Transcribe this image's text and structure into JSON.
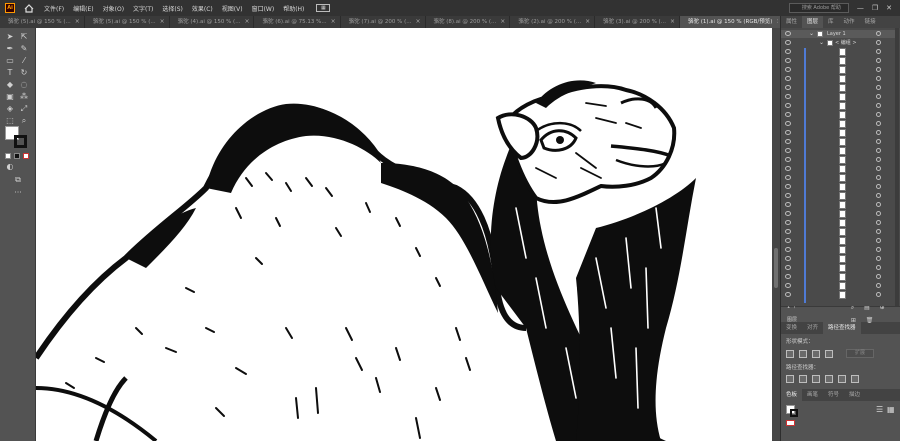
{
  "app": {
    "logo": "Ai"
  },
  "menubar": {
    "items": [
      "文件(F)",
      "编辑(E)",
      "对象(O)",
      "文字(T)",
      "选择(S)",
      "效果(C)",
      "视图(V)",
      "窗口(W)",
      "帮助(H)"
    ],
    "search_placeholder": "搜索 Adobe 帮助"
  },
  "tabs": [
    {
      "label": "骆驼 (5).ai @ 150 % (..."
    },
    {
      "label": "骆驼 (5).ai @ 150 % (..."
    },
    {
      "label": "骆驼 (4).ai @ 150 % (..."
    },
    {
      "label": "骆驼 (6).ai @ 75.13 %..."
    },
    {
      "label": "骆驼 (7).ai @ 200 % (..."
    },
    {
      "label": "骆驼 (8).ai @ 200 % (..."
    },
    {
      "label": "骆驼 (2).ai @ 200 % (..."
    },
    {
      "label": "骆驼 (3).ai @ 200 % (..."
    },
    {
      "label": "骆驼 (1).ai @ 150 % (RGB/预览)"
    }
  ],
  "panels": {
    "top_tabs": [
      "属性",
      "图层",
      "库",
      "动作",
      "链接"
    ],
    "layer_name": "Layer 1",
    "group_name": "< 编组 >",
    "footer_count": "1 个图层",
    "pathfinder_tabs": [
      "变换",
      "对齐",
      "路径查找器"
    ],
    "shape_modes_label": "形状模式：",
    "pathfinders_label": "路径查找器：",
    "expand_label": "扩展",
    "swatch_tabs": [
      "色板",
      "画笔",
      "符号",
      "描边"
    ]
  },
  "colors": {
    "accent": "#4f7bd6",
    "canvas": "#ffffff",
    "ui_dark": "#323232",
    "ui_mid": "#535353"
  }
}
